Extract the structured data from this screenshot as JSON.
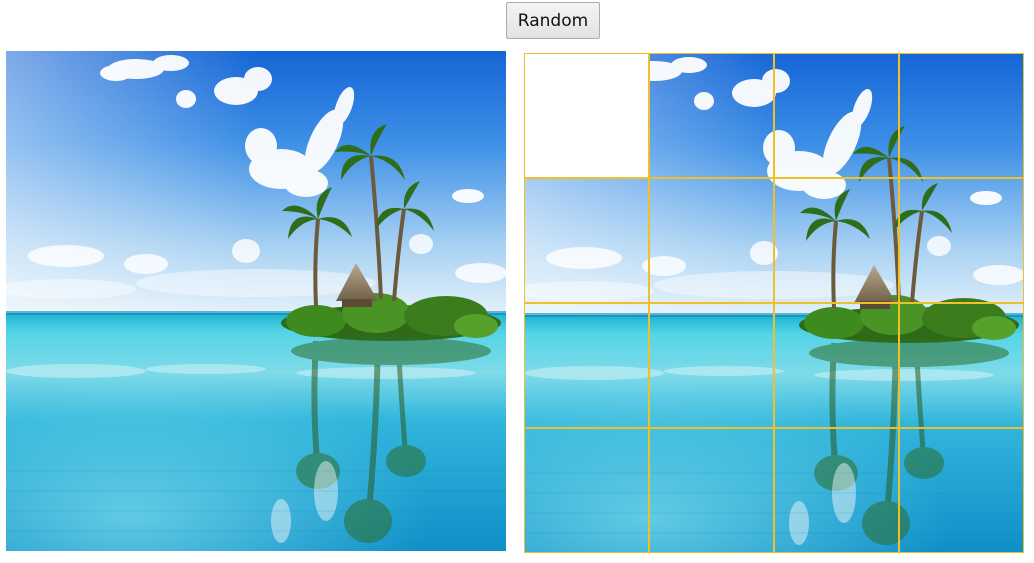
{
  "controls": {
    "random_label": "Random"
  },
  "reference_image": {
    "subject": "tropical-island-scene"
  },
  "puzzle": {
    "grid_size": 4,
    "empty_tile": 0,
    "tiles": [
      {
        "tile": 0,
        "piece": null
      },
      {
        "tile": 1,
        "piece": 1
      },
      {
        "tile": 2,
        "piece": 2
      },
      {
        "tile": 3,
        "piece": 3
      },
      {
        "tile": 4,
        "piece": 4
      },
      {
        "tile": 5,
        "piece": 5
      },
      {
        "tile": 6,
        "piece": 6
      },
      {
        "tile": 7,
        "piece": 7
      },
      {
        "tile": 8,
        "piece": 8
      },
      {
        "tile": 9,
        "piece": 9
      },
      {
        "tile": 10,
        "piece": 10
      },
      {
        "tile": 11,
        "piece": 11
      },
      {
        "tile": 12,
        "piece": 12
      },
      {
        "tile": 13,
        "piece": 13
      },
      {
        "tile": 14,
        "piece": 14
      },
      {
        "tile": 15,
        "piece": 15
      }
    ]
  },
  "colors": {
    "tile_border": "#f0c02a",
    "sky_top": "#1e6fd9",
    "sky_horizon": "#cfe6f7",
    "sea_light": "#5fd3e3",
    "sea_deep": "#1797c9",
    "foliage": "#3f7f1f"
  }
}
